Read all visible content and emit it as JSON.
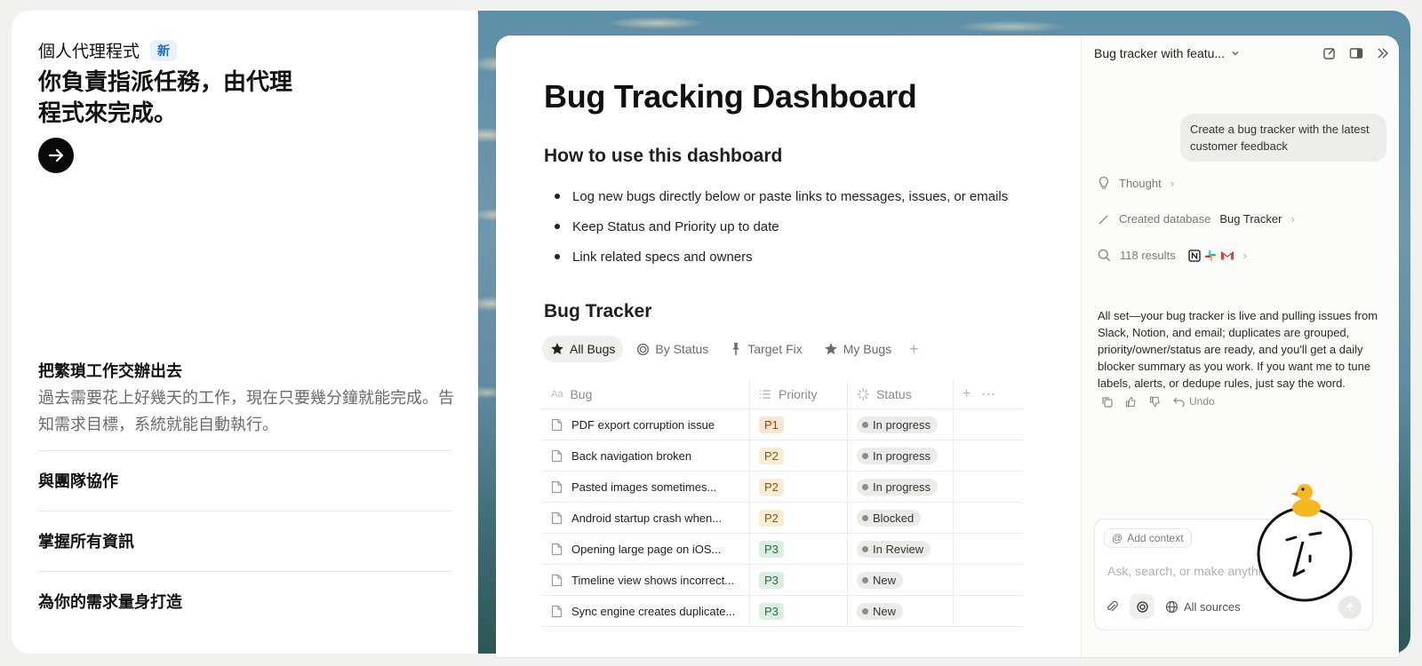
{
  "marketing": {
    "eyebrow": "個人代理程式",
    "badge": "新",
    "headline": "你負責指派任務，由代理程式來完成。",
    "feature": {
      "title": "把繁瑣工作交辦出去",
      "desc": "過去需要花上好幾天的工作，現在只要幾分鐘就能完成。告知需求目標，系統就能自動執行。"
    },
    "rows": [
      "與團隊協作",
      "掌握所有資訊",
      "為你的需求量身打造"
    ]
  },
  "doc": {
    "title": "Bug Tracking Dashboard",
    "howto_title": "How to use this dashboard",
    "howto": [
      "Log new bugs directly below or paste links to messages, issues, or emails",
      "Keep Status and Priority up to date",
      "Link related specs and owners"
    ],
    "tracker_title": "Bug Tracker",
    "views": [
      {
        "label": "All Bugs",
        "icon": "star-icon",
        "active": true
      },
      {
        "label": "By Status",
        "icon": "target-icon",
        "active": false
      },
      {
        "label": "Target Fix",
        "icon": "pin-icon",
        "active": false
      },
      {
        "label": "My Bugs",
        "icon": "star-icon",
        "active": false
      }
    ],
    "columns": {
      "bug": "Bug",
      "bug_glyph": "Aa",
      "priority": "Priority",
      "status": "Status"
    },
    "rows": [
      {
        "bug": "PDF export corruption issue",
        "priority": "P1",
        "status": "In progress"
      },
      {
        "bug": "Back navigation broken",
        "priority": "P2",
        "status": "In progress"
      },
      {
        "bug": "Pasted images sometimes...",
        "priority": "P2",
        "status": "In progress"
      },
      {
        "bug": "Android startup crash when...",
        "priority": "P2",
        "status": "Blocked"
      },
      {
        "bug": "Opening large page on iOS...",
        "priority": "P3",
        "status": "In Review"
      },
      {
        "bug": "Timeline view shows incorrect...",
        "priority": "P3",
        "status": "New"
      },
      {
        "bug": "Sync engine creates duplicate...",
        "priority": "P3",
        "status": "New"
      }
    ]
  },
  "chat": {
    "title": "Bug tracker with featu...",
    "user_message": "Create a bug tracker with the latest customer feedback",
    "thought": "Thought",
    "created_prefix": "Created database",
    "created_name": "Bug Tracker",
    "results": "118 results",
    "answer": "All set—your bug tracker is live and pulling issues from Slack, Notion, and email; duplicates are grouped, priority/owner/status are ready, and you'll get a daily blocker summary as you work. If you want me to tune labels, alerts, or dedupe rules, just say the word.",
    "undo": "Undo",
    "add_context": "Add context",
    "placeholder": "Ask, search, or make anything...",
    "all_sources": "All sources"
  }
}
